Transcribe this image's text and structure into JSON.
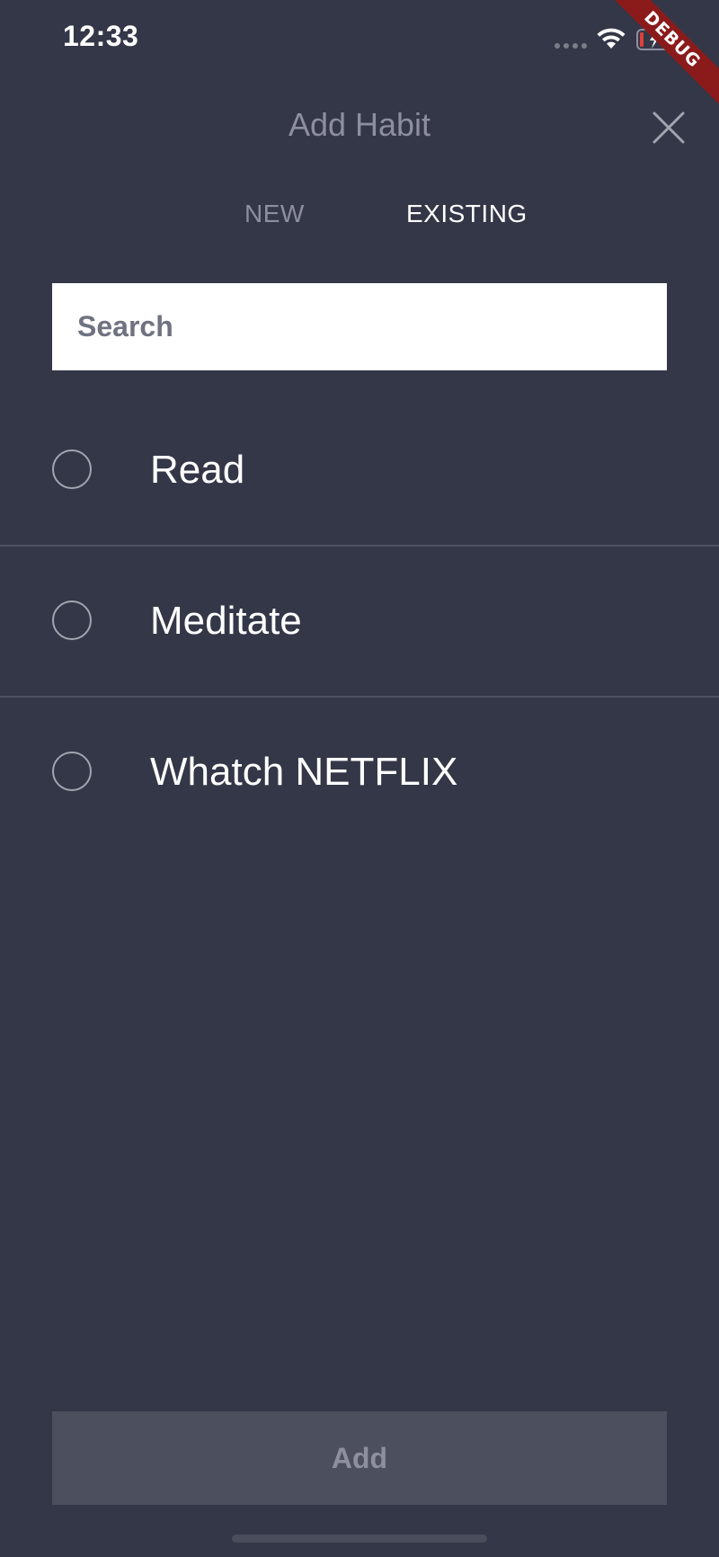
{
  "status_bar": {
    "time": "12:33"
  },
  "debug_banner": "DEBUG",
  "header": {
    "title": "Add Habit"
  },
  "tabs": [
    {
      "label": "NEW",
      "active": false
    },
    {
      "label": "EXISTING",
      "active": true
    }
  ],
  "search": {
    "placeholder": "Search",
    "value": ""
  },
  "habits": [
    {
      "label": "Read",
      "selected": false
    },
    {
      "label": "Meditate",
      "selected": false
    },
    {
      "label": "Whatch NETFLIX",
      "selected": false
    }
  ],
  "footer": {
    "add_label": "Add"
  },
  "icons": {
    "close": "close-icon",
    "wifi": "wifi-icon",
    "battery": "battery-charging-icon",
    "signal": "signal-icon"
  },
  "colors": {
    "background": "#343747",
    "muted_text": "#8d8fa0",
    "button_bg": "#4c4f5d",
    "debug_ribbon": "#8b1b1b",
    "battery_low": "#e0403a"
  }
}
